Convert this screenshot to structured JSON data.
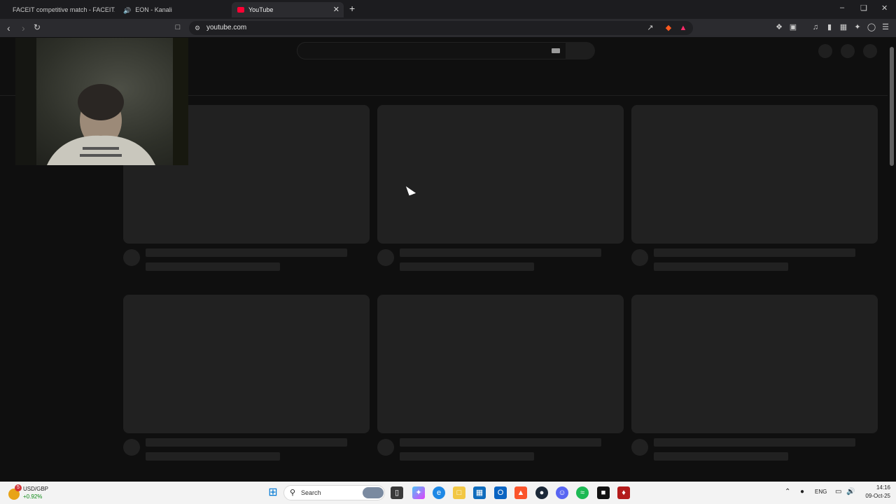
{
  "browser": {
    "tabs": [
      {
        "title": "FACEIT competitive match - FACEIT.c",
        "icon": "faceit-favicon"
      },
      {
        "title": "EON - Kanali",
        "icon": "speaker-favicon"
      },
      {
        "title": "YouTube",
        "icon": "youtube-favicon",
        "active": true
      }
    ],
    "address": "youtube.com",
    "accent": "#ff2a2a"
  },
  "taskbar": {
    "widget_title": "USD/GBP",
    "widget_change": "+0.92%",
    "widget_badge": "5",
    "search_label": "Search",
    "lang": "ENG",
    "time": "14:16",
    "date": "09-Oct-25"
  }
}
